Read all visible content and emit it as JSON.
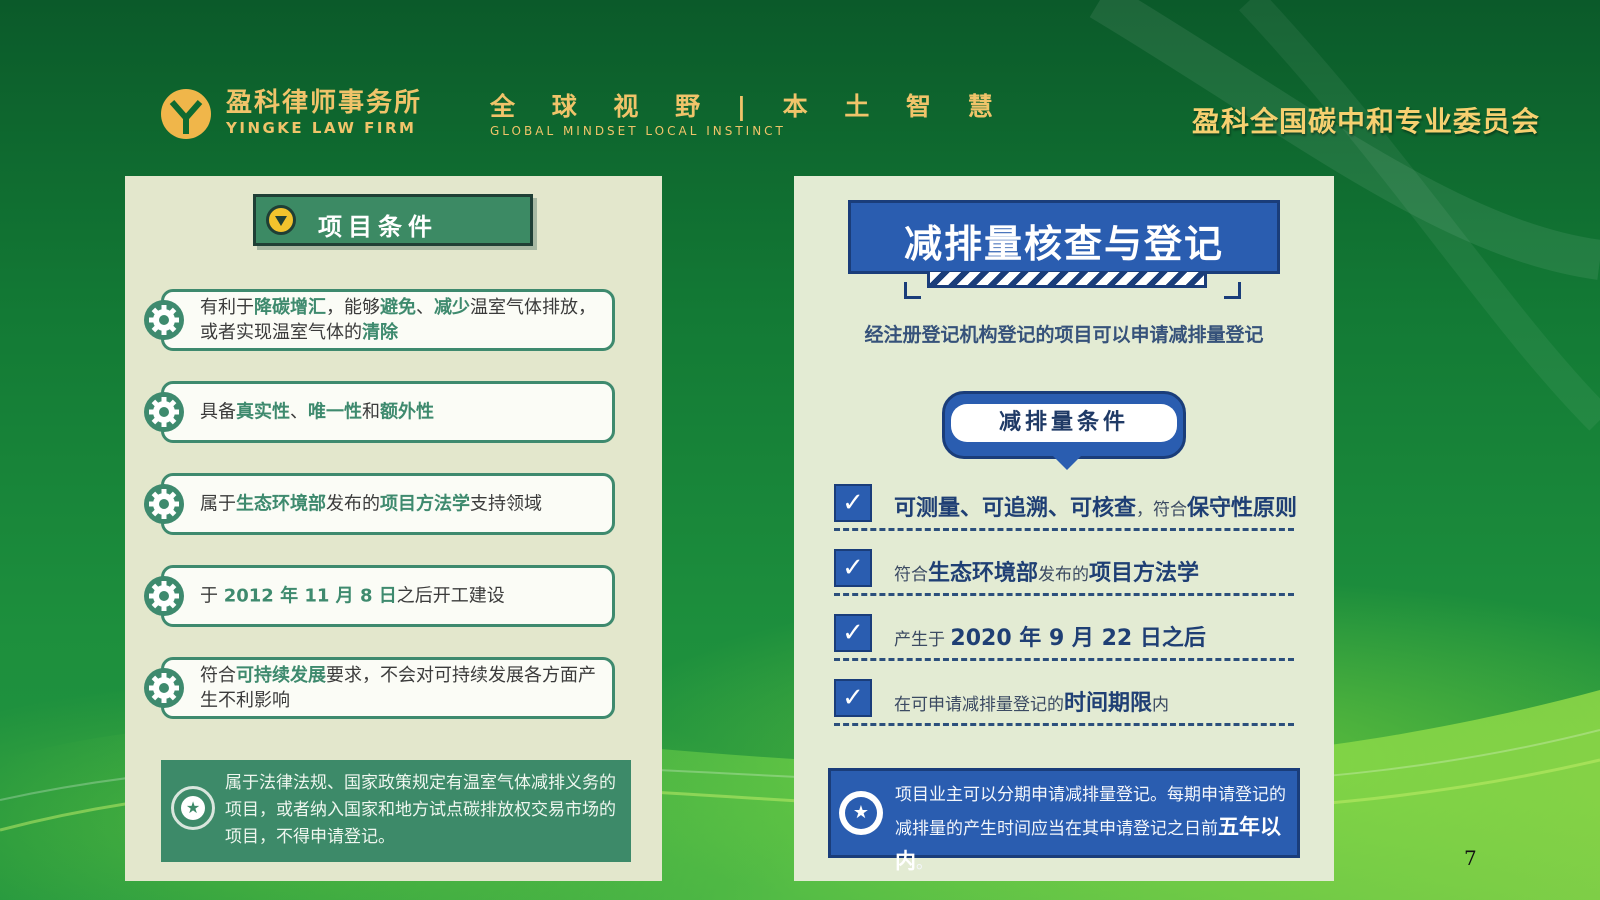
{
  "header": {
    "firm_cn": "盈科律师事务所",
    "firm_en": "YINGKE LAW FIRM",
    "slogan_cn": "全 球 视 野 | 本 土 智 慧",
    "slogan_en": "GLOBAL MINDSET   LOCAL INSTINCT",
    "committee": "盈科全国碳中和专业委员会",
    "brand_color": "#f0c46a"
  },
  "left": {
    "section_title": "项目条件",
    "items": [
      {
        "segments": [
          [
            "有利于",
            0
          ],
          [
            "降碳增汇",
            1
          ],
          [
            "，能够",
            0
          ],
          [
            "避免",
            1
          ],
          [
            "、",
            0
          ],
          [
            "减少",
            1
          ],
          [
            "温室气体排放，或者实现温室气体的",
            0
          ],
          [
            "清除",
            1
          ]
        ]
      },
      {
        "segments": [
          [
            "具备",
            0
          ],
          [
            "真实性",
            1
          ],
          [
            "、",
            0
          ],
          [
            "唯一性",
            1
          ],
          [
            "和",
            0
          ],
          [
            "额外性",
            1
          ]
        ]
      },
      {
        "segments": [
          [
            "属于",
            0
          ],
          [
            "生态环境部",
            1
          ],
          [
            "发布的",
            0
          ],
          [
            "项目方法学",
            1
          ],
          [
            "支持领域",
            0
          ]
        ]
      },
      {
        "segments": [
          [
            "于 ",
            0
          ],
          [
            "2012 年 11 月 8 日",
            1
          ],
          [
            "之后开工建设",
            0
          ]
        ]
      },
      {
        "segments": [
          [
            "符合",
            0
          ],
          [
            "可持续发展",
            1
          ],
          [
            "要求，不会对可持续发展各方面产生不利影响",
            0
          ]
        ]
      }
    ],
    "note": "属于法律法规、国家政策规定有温室气体减排义务的项目，或者纳入国家和地方试点碳排放权交易市场的项目，不得申请登记。",
    "accent_color": "#3e8a6e"
  },
  "right": {
    "title": "减排量核查与登记",
    "subtitle": "经注册登记机构登记的项目可以申请减排量登记",
    "conditions_title": "减排量条件",
    "conditions": [
      {
        "segments": [
          [
            "可测量、可追溯、可核查",
            1
          ],
          [
            "，符合",
            0
          ],
          [
            "保守性原则",
            1
          ]
        ]
      },
      {
        "segments": [
          [
            "符合",
            0
          ],
          [
            "生态环境部",
            1
          ],
          [
            "发布的",
            0
          ],
          [
            "项目方法学",
            1
          ]
        ]
      },
      {
        "segments": [
          [
            "产生于 ",
            0
          ],
          [
            "2020 年 9 月 22 日之后",
            1
          ]
        ]
      },
      {
        "segments": [
          [
            "在可申请减排量登记的",
            0
          ],
          [
            "时间期限",
            1
          ],
          [
            "内",
            0
          ]
        ]
      }
    ],
    "note_segments": [
      [
        "项目业主可以分期申请减排量登记。每期申请登记的减排量的产生时间应当在其申请登记之日前",
        0
      ],
      [
        "五年以内",
        1
      ],
      [
        "。",
        0
      ]
    ],
    "accent_color": "#2a5db0"
  },
  "page_number": "7"
}
